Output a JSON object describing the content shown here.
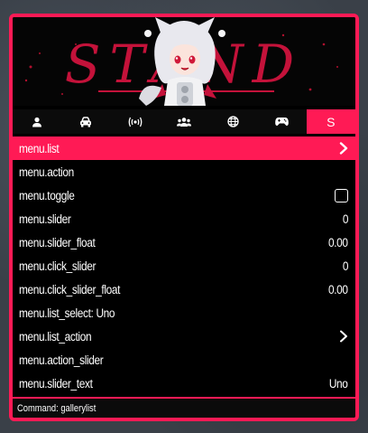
{
  "header": {
    "logo_text": "STAND",
    "accent_color": "#ff1a55"
  },
  "tabs": [
    {
      "name": "user-icon",
      "label": ""
    },
    {
      "name": "car-icon",
      "label": ""
    },
    {
      "name": "broadcast-icon",
      "label": ""
    },
    {
      "name": "group-icon",
      "label": ""
    },
    {
      "name": "globe-icon",
      "label": ""
    },
    {
      "name": "gamepad-icon",
      "label": ""
    },
    {
      "name": "stand-tab",
      "label": "S"
    }
  ],
  "items": [
    {
      "label": "menu.list",
      "value": "",
      "widget": "chevron-right-icon"
    },
    {
      "label": "menu.action",
      "value": "",
      "widget": ""
    },
    {
      "label": "menu.toggle",
      "value": "",
      "widget": "checkbox"
    },
    {
      "label": "menu.slider",
      "value": "0",
      "widget": ""
    },
    {
      "label": "menu.slider_float",
      "value": "0.00",
      "widget": ""
    },
    {
      "label": "menu.click_slider",
      "value": "0",
      "widget": ""
    },
    {
      "label": "menu.click_slider_float",
      "value": "0.00",
      "widget": ""
    },
    {
      "label": "menu.list_select: Uno",
      "value": "",
      "widget": ""
    },
    {
      "label": "menu.list_action",
      "value": "",
      "widget": "chevron-right-icon"
    },
    {
      "label": "menu.action_slider",
      "value": "",
      "widget": ""
    },
    {
      "label": "menu.slider_text",
      "value": "Uno",
      "widget": ""
    }
  ],
  "footer": {
    "command_text": "Command: gallerylist"
  }
}
